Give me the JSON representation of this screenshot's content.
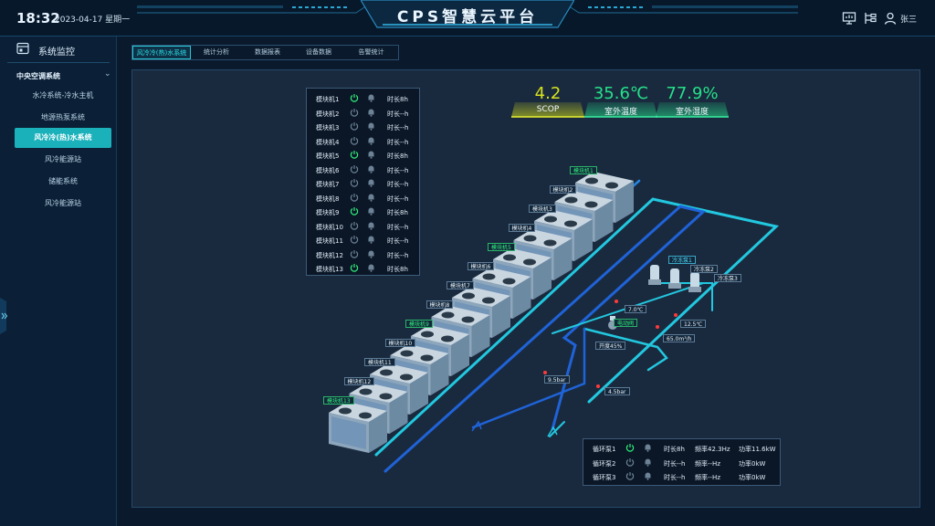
{
  "header": {
    "time": "18:32",
    "date": "2023-04-17 星期一",
    "title": "CPS智慧云平台",
    "user": "张三",
    "icons": [
      "monitor-icon",
      "hierarchy-icon",
      "user-icon"
    ]
  },
  "sidebar": {
    "title": "系统监控",
    "group": "中央空调系统",
    "items": [
      {
        "label": "水冷系统-冷水主机",
        "active": false
      },
      {
        "label": "地源热泵系统",
        "active": false
      },
      {
        "label": "风冷冷(热)水系统",
        "active": true
      },
      {
        "label": "风冷能源站",
        "active": false
      },
      {
        "label": "储能系统",
        "active": false
      },
      {
        "label": "风冷能源站",
        "active": false
      }
    ]
  },
  "tabs": [
    "风冷冷(热)水系统",
    "统计分析",
    "数据报表",
    "设备数据",
    "告警统计"
  ],
  "kpis": [
    {
      "value": "4.2",
      "label": "SCOP",
      "color": "#d6e21c"
    },
    {
      "value": "35.6℃",
      "label": "室外温度",
      "color": "#25e08a"
    },
    {
      "value": "77.9%",
      "label": "室外湿度",
      "color": "#25e08a"
    }
  ],
  "units": [
    {
      "name": "模块机1",
      "on": true,
      "duration": "时长8h"
    },
    {
      "name": "模块机2",
      "on": false,
      "duration": "时长--h"
    },
    {
      "name": "模块机3",
      "on": false,
      "duration": "时长--h"
    },
    {
      "name": "模块机4",
      "on": false,
      "duration": "时长--h"
    },
    {
      "name": "模块机5",
      "on": true,
      "duration": "时长8h"
    },
    {
      "name": "模块机6",
      "on": false,
      "duration": "时长--h"
    },
    {
      "name": "模块机7",
      "on": false,
      "duration": "时长--h"
    },
    {
      "name": "模块机8",
      "on": false,
      "duration": "时长--h"
    },
    {
      "name": "模块机9",
      "on": true,
      "duration": "时长8h"
    },
    {
      "name": "模块机10",
      "on": false,
      "duration": "时长--h"
    },
    {
      "name": "模块机11",
      "on": false,
      "duration": "时长--h"
    },
    {
      "name": "模块机12",
      "on": false,
      "duration": "时长--h"
    },
    {
      "name": "模块机13",
      "on": true,
      "duration": "时长8h"
    }
  ],
  "scene": {
    "unit_tags": [
      "模块机1",
      "模块机2",
      "模块机3",
      "模块机4",
      "模块机5",
      "模块机6",
      "模块机7",
      "模块机8",
      "模块机9",
      "模块机10",
      "模块机11",
      "模块机12",
      "模块机13"
    ],
    "pump_tags": [
      "冷冻泵1",
      "冷冻泵2",
      "冷冻泵3"
    ],
    "valve_label": "电动阀",
    "valve_open": "开度45%",
    "supply_temp": "7.0℃",
    "return_temp": "12.5℃",
    "flow": "65.0m³/h",
    "pressure_1": "9.5bar",
    "pressure_2": "4.5bar"
  },
  "pumps": [
    {
      "name": "循环泵1",
      "on": true,
      "duration": "时长8h",
      "freq": "频率42.3Hz",
      "power": "功率11.6kW"
    },
    {
      "name": "循环泵2",
      "on": false,
      "duration": "时长--h",
      "freq": "频率--Hz",
      "power": "功率0kW"
    },
    {
      "name": "循环泵3",
      "on": false,
      "duration": "时长--h",
      "freq": "频率--Hz",
      "power": "功率0kW"
    }
  ],
  "colors": {
    "on": "#2ff07a",
    "off": "#6c8296",
    "accent": "#1ab1bb",
    "pipe_cyan": "#22c8e0",
    "pipe_blue": "#1f63d8"
  }
}
